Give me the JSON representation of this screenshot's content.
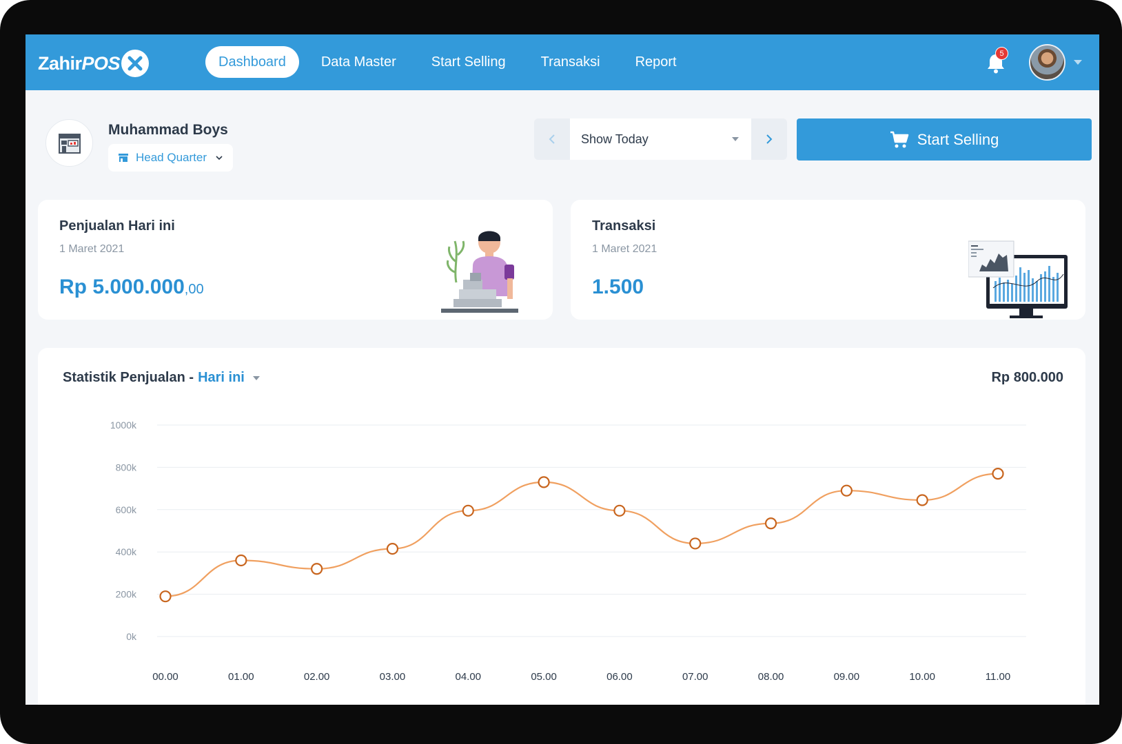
{
  "app": {
    "logo_text": "Zahir",
    "logo_pos": "POS",
    "brand_color": "#339ada"
  },
  "nav": {
    "items": [
      {
        "label": "Dashboard",
        "active": true
      },
      {
        "label": "Data Master",
        "active": false
      },
      {
        "label": "Start Selling",
        "active": false
      },
      {
        "label": "Transaksi",
        "active": false
      },
      {
        "label": "Report",
        "active": false
      }
    ],
    "notification_count": "5"
  },
  "store": {
    "name": "Muhammad Boys",
    "branch": "Head Quarter"
  },
  "date_filter": {
    "selected": "Show Today"
  },
  "actions": {
    "start_selling": "Start Selling"
  },
  "cards": {
    "sales": {
      "title": "Penjualan Hari ini",
      "date": "1 Maret 2021",
      "value": "Rp 5.000.000",
      "value_decimal": ",00"
    },
    "transactions": {
      "title": "Transaksi",
      "date": "1 Maret 2021",
      "value": "1.500"
    }
  },
  "chart": {
    "title": "Statistik Penjualan -",
    "period": "Hari ini",
    "total": "Rp 800.000"
  },
  "chart_data": {
    "type": "line",
    "x": [
      "00.00",
      "01.00",
      "02.00",
      "03.00",
      "04.00",
      "05.00",
      "06.00",
      "07.00",
      "08.00",
      "09.00",
      "10.00",
      "11.00"
    ],
    "series": [
      {
        "values": [
          190,
          360,
          320,
          415,
          595,
          730,
          595,
          440,
          535,
          690,
          645,
          770
        ]
      }
    ],
    "yticks": [
      "0k",
      "200k",
      "400k",
      "600k",
      "800k",
      "1000k"
    ],
    "ylim": [
      0,
      1000
    ],
    "grid": true,
    "line_color": "#f0a060",
    "marker_color": "#c8651e"
  }
}
